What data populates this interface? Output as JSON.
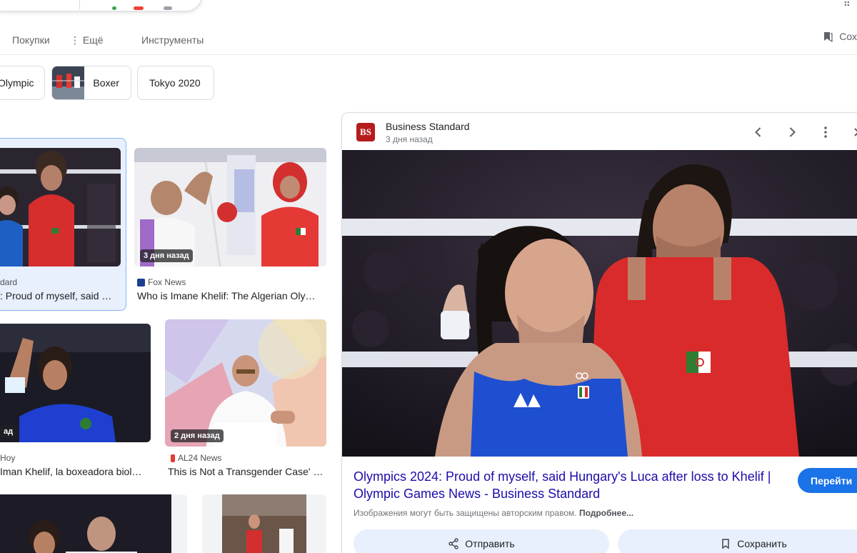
{
  "toolbar": {
    "shopping": "Покупки",
    "more": "⋮ Ещё",
    "tools": "Инструменты",
    "saved": "Сох"
  },
  "chips": [
    {
      "label": "Olympic"
    },
    {
      "label": "Boxer"
    },
    {
      "label": "Tokyo 2020"
    }
  ],
  "results": [
    {
      "source": "dard",
      "title": ": Proud of myself, said Hungary's Luca..."
    },
    {
      "source": "Fox News",
      "title": "Who is Imane Khelif: The Algerian Olympic...",
      "badge": "3 дня назад"
    },
    {
      "source": "Hoy",
      "title": "Iman Khelif, la boxeadora biológica...",
      "badge": "ад"
    },
    {
      "source": "AL24 News",
      "title": "This is Not a Transgender Case' - IOC...",
      "badge": "2 дня назад"
    }
  ],
  "preview": {
    "source": "Business Standard",
    "logo_text": "BS",
    "time": "3 дня назад",
    "title": "Olympics 2024: Proud of myself, said Hungary's Luca after loss to Khelif | Olympic Games News - Business Standard",
    "go_label": "Перейти",
    "copyright": "Изображения могут быть защищены авторским правом.",
    "copyright_more": "Подробнее...",
    "share_label": "Отправить",
    "save_label": "Сохранить"
  },
  "colors": {
    "link": "#1a0dab",
    "accent": "#1a73e8",
    "selected_bg": "#e8f0fe"
  }
}
